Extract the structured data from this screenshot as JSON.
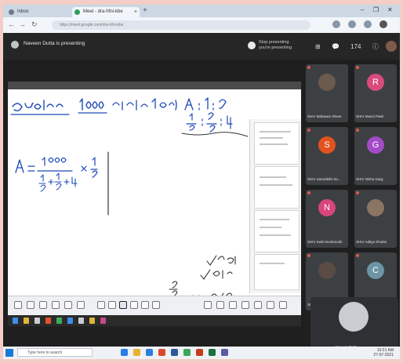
{
  "browser": {
    "tabs": [
      {
        "label": "Inbox"
      },
      {
        "label": "Meet - dra-hfni-kbe"
      }
    ],
    "url": "https://meet.google.com/dra-hfni-kbe",
    "new_tab": "+",
    "controls": [
      "–",
      "❐",
      "✕"
    ]
  },
  "meet": {
    "presenting_text": "Naveen Dutta is presenting",
    "you_presenting": "Stop presenting\nyou're presenting",
    "top_icons": [
      "⊞",
      "💬",
      "ⓘ"
    ],
    "participant_count": "174",
    "participants": [
      {
        "name": "SHIV Mahawar Shree",
        "initial": "",
        "color": "#6b5b4e",
        "photo": true
      },
      {
        "name": "SHIV Mansi Patel",
        "initial": "R",
        "color": "#d94b7b"
      },
      {
        "name": "SHIV Samriddhi Sa...",
        "initial": "S",
        "color": "#e2531f"
      },
      {
        "name": "SHIV Nisha Garg",
        "initial": "G",
        "color": "#a34bc6"
      },
      {
        "name": "SHIV Ketki Deshmukh",
        "initial": "N",
        "color": "#d8457c"
      },
      {
        "name": "SHIV Aditya Shukla",
        "initial": "",
        "color": "#8a7462",
        "photo": true
      },
      {
        "name": "SHIV Abhishek Singh",
        "initial": "",
        "color": "#5a4b44",
        "photo": true
      },
      {
        "name": "SHIV Aditya Chandra",
        "initial": "C",
        "color": "#6c95a6"
      }
    ],
    "self_name": "Naveen Dutta"
  },
  "whiteboard": {
    "toolbar_icons": [
      "undo-icon",
      "redo-icon",
      "pen-icon",
      "marker-icon",
      "eraser-icon",
      "select-icon",
      "shape-icon",
      "text-icon",
      "image-icon",
      "clear-icon",
      "lasso-icon",
      "zoom-icon"
    ],
    "page_nav": [
      "‹",
      "›",
      "+"
    ]
  },
  "taskbar": {
    "search_placeholder": "Type here to search",
    "time": "10:21 AM",
    "date": "27-07-2021"
  }
}
